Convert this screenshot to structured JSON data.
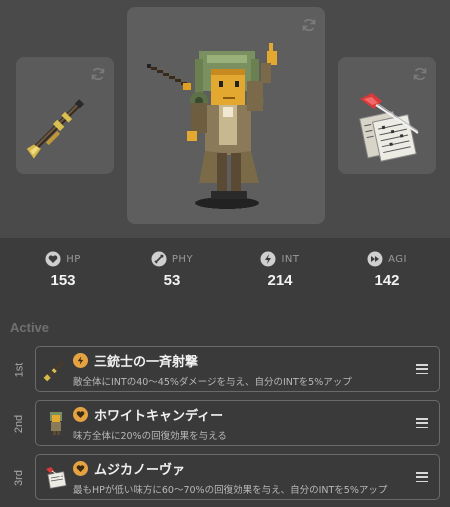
{
  "loadout": {
    "weapon": {
      "name": "musket-weapon"
    },
    "character": {
      "name": "conductor-character"
    },
    "accessory": {
      "name": "sheet-music-accessory"
    }
  },
  "stats": [
    {
      "key": "hp",
      "label": "HP",
      "value": "153",
      "icon": "heart-icon"
    },
    {
      "key": "phy",
      "label": "PHY",
      "value": "53",
      "icon": "sword-icon"
    },
    {
      "key": "int",
      "label": "INT",
      "value": "214",
      "icon": "lightning-icon"
    },
    {
      "key": "agi",
      "label": "AGI",
      "value": "142",
      "icon": "fast-forward-icon"
    }
  ],
  "active": {
    "title": "Active",
    "slots": [
      {
        "rank": "1st",
        "name": "三銃士の一斉射撃",
        "type_icon": "lightning-icon",
        "desc": "敵全体にINTの40～45%ダメージを与え、自分のINTを5%アップ"
      },
      {
        "rank": "2nd",
        "name": "ホワイトキャンディー",
        "type_icon": "heart-icon",
        "desc": "味方全体に20%の回復効果を与える"
      },
      {
        "rank": "3rd",
        "name": "ムジカノーヴァ",
        "type_icon": "heart-icon",
        "desc": "最もHPが低い味方に60～70%の回復効果を与え、自分のINTを5%アップ"
      }
    ]
  },
  "colors": {
    "accent": "#e5a242",
    "panel": "#4a4a4a",
    "background": "#3c3c3c"
  }
}
